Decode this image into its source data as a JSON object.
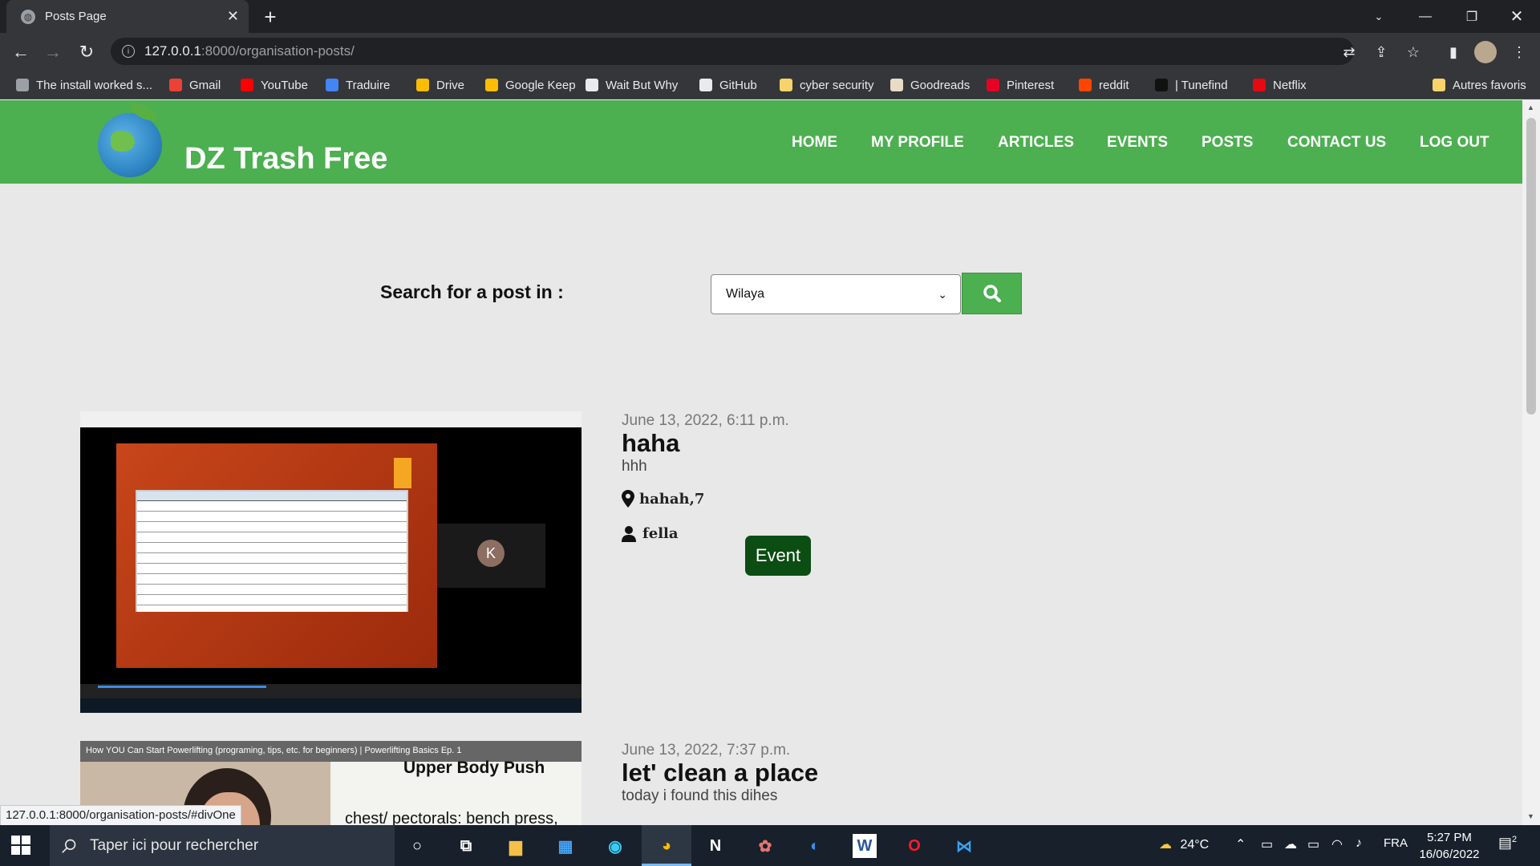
{
  "browser": {
    "tab_title": "Posts Page",
    "tab_close": "✕",
    "new_tab": "+",
    "url_host": "127.0.0.1",
    "url_path": ":8000/organisation-posts/",
    "bookmarks": [
      {
        "label": "The install worked s...",
        "color": "#9aa0a6"
      },
      {
        "label": "Gmail",
        "color": "#ea4335"
      },
      {
        "label": "YouTube",
        "color": "#ff0000"
      },
      {
        "label": "Traduire",
        "color": "#4285f4"
      },
      {
        "label": "Drive",
        "color": "#fbbc04"
      },
      {
        "label": "Google Keep",
        "color": "#fbbc04"
      },
      {
        "label": "Wait But Why",
        "color": "#e8eaed"
      },
      {
        "label": "GitHub",
        "color": "#e8eaed"
      },
      {
        "label": "cyber security",
        "color": "#f6d36b"
      },
      {
        "label": "Goodreads",
        "color": "#e8dcc5"
      },
      {
        "label": "Pinterest",
        "color": "#e60023"
      },
      {
        "label": "reddit",
        "color": "#ff4500"
      },
      {
        "label": "| Tunefind",
        "color": "#111111"
      },
      {
        "label": "Netflix",
        "color": "#e50914"
      }
    ],
    "other_bookmarks": "Autres favoris",
    "status_url": "127.0.0.1:8000/organisation-posts/#divOne"
  },
  "site": {
    "brand": "DZ Trash Free",
    "accent": "#4caf50",
    "nav": [
      "HOME",
      "MY PROFILE",
      "ARTICLES",
      "EVENTS",
      "POSTS",
      "CONTACT US",
      "LOG OUT"
    ]
  },
  "search": {
    "label": "Search for a post in :",
    "select_value": "Wilaya",
    "button_icon": "search-icon"
  },
  "posts": [
    {
      "date": "June 13, 2022, 6:11 p.m.",
      "title": "haha",
      "description": "hhh",
      "location": "hahah,7",
      "author": "fella",
      "tag": "Event",
      "image_caption": "K"
    },
    {
      "date": "June 13, 2022, 7:37 p.m.",
      "title": "let' clean a place",
      "description": "today i found this dihes",
      "image_video_title": "How YOU Can Start Powerlifting (programing, tips, etc. for beginners) | Powerlifting Basics Ep. 1",
      "image_heading": "Upper Body Push",
      "image_subtext": "chest/ pectorals: bench press,"
    }
  ],
  "taskbar": {
    "search_placeholder": "Taper ici pour rechercher",
    "temperature": "24°C",
    "language": "FRA",
    "time": "5:27 PM",
    "date": "16/06/2022",
    "notifications": "2"
  }
}
